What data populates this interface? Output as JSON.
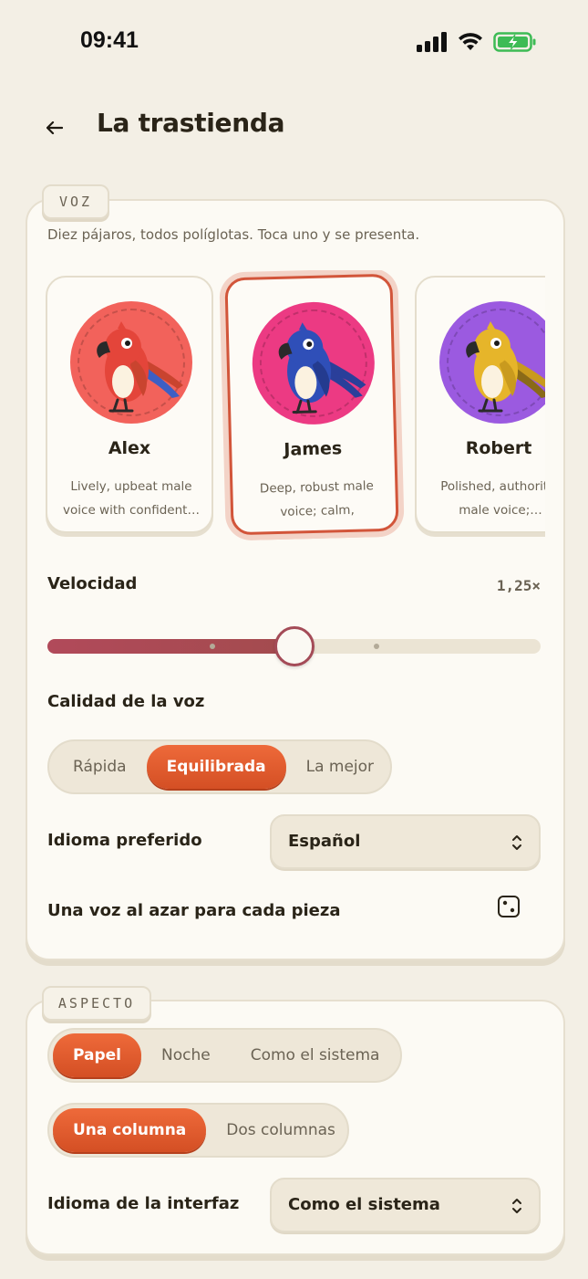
{
  "status": {
    "time": "09:41"
  },
  "header": {
    "back_icon": "arrow-left-icon",
    "title": "La trastienda"
  },
  "voz": {
    "tag": "VOZ",
    "description": "Diez pájaros, todos políglotas. Toca uno y se presenta.",
    "voices": [
      {
        "name": "Alex",
        "description": "Lively, upbeat male voice with confident…",
        "bg": "#f2625b",
        "bird": "#e4453a",
        "wing": "#c9442f",
        "selected": false
      },
      {
        "name": "James",
        "description": "Deep, robust male voice; calm, compose…",
        "bg": "#ec3a83",
        "bird": "#2f4fb8",
        "wing": "#2a3f9a",
        "selected": true
      },
      {
        "name": "Robert",
        "description": "Polished, authoritat male voice;…",
        "bg": "#9b5ae0",
        "bird": "#e6b52a",
        "wing": "#c99a1e",
        "selected": false
      }
    ],
    "speed": {
      "label": "Velocidad",
      "value_text": "1,25×",
      "fraction": 0.5
    },
    "quality": {
      "label": "Calidad de la voz",
      "options": [
        "Rápida",
        "Equilibrada",
        "La mejor"
      ],
      "selected": "Equilibrada"
    },
    "language": {
      "label": "Idioma preferido",
      "value": "Español"
    },
    "random": {
      "label": "Una voz al azar para cada pieza",
      "icon": "dice-icon"
    }
  },
  "aspecto": {
    "tag": "ASPECTO",
    "theme": {
      "options": [
        "Papel",
        "Noche",
        "Como el sistema"
      ],
      "selected": "Papel"
    },
    "layout": {
      "options": [
        "Una columna",
        "Dos columnas"
      ],
      "selected": "Una columna"
    },
    "ui_language": {
      "label": "Idioma de la interfaz",
      "value": "Como el sistema"
    }
  },
  "colors": {
    "accent": "#e15a2c",
    "slider": "#a44b57",
    "background": "#f3efe5",
    "card": "#fcfaf4"
  }
}
